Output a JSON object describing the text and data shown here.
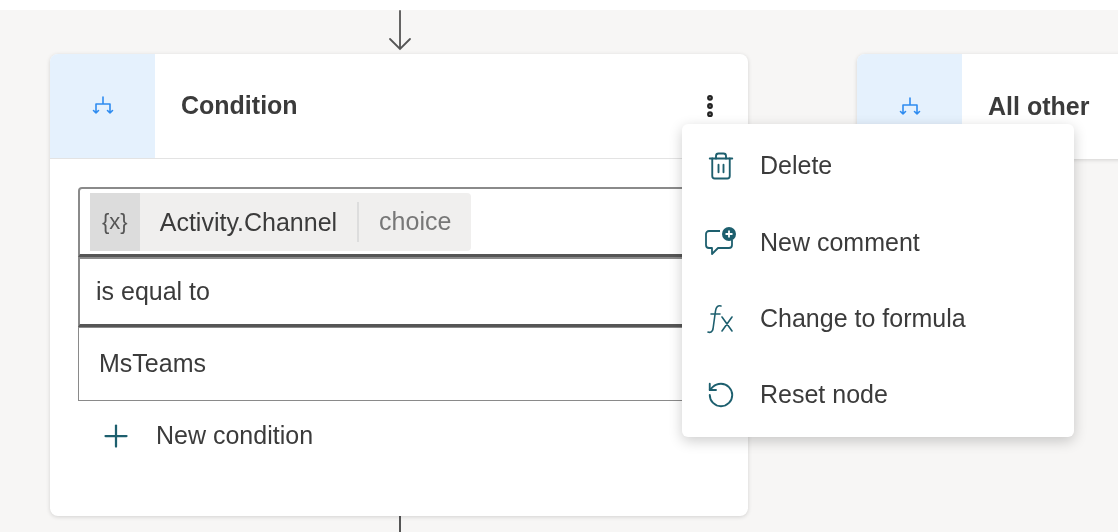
{
  "condition_node": {
    "title": "Condition",
    "variable": {
      "badge": "{x}",
      "name": "Activity.Channel",
      "type": "choice"
    },
    "operator": "is equal to",
    "value": "MsTeams",
    "add_button": "New condition"
  },
  "other_node": {
    "title": "All other"
  },
  "context_menu": [
    {
      "kind": "delete",
      "label": "Delete"
    },
    {
      "kind": "comment",
      "label": "New comment"
    },
    {
      "kind": "formula",
      "label": "Change to formula"
    },
    {
      "kind": "reset",
      "label": "Reset node"
    }
  ]
}
